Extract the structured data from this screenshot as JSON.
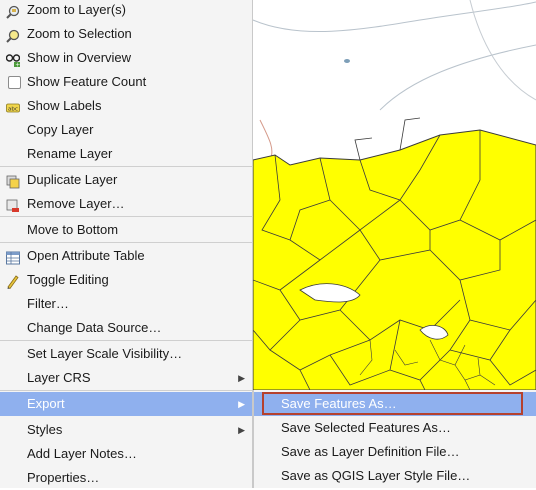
{
  "context_menu": {
    "items": [
      {
        "label": "Zoom to Layer(s)",
        "icon": "zoom-layer-icon"
      },
      {
        "label": "Zoom to Selection",
        "icon": "zoom-selection-icon"
      },
      {
        "label": "Show in Overview",
        "icon": "overview-icon"
      },
      {
        "label": "Show Feature Count",
        "icon": "checkbox-icon"
      },
      {
        "label": "Show Labels",
        "icon": "labels-icon"
      },
      {
        "label": "Copy Layer"
      },
      {
        "label": "Rename Layer"
      },
      {
        "label": "Duplicate Layer",
        "icon": "duplicate-layer-icon"
      },
      {
        "label": "Remove Layer…",
        "icon": "remove-layer-icon"
      },
      {
        "label": "Move to Bottom"
      },
      {
        "label": "Open Attribute Table",
        "icon": "attribute-table-icon"
      },
      {
        "label": "Toggle Editing",
        "icon": "pencil-icon"
      },
      {
        "label": "Filter…"
      },
      {
        "label": "Change Data Source…"
      },
      {
        "label": "Set Layer Scale Visibility…"
      },
      {
        "label": "Layer CRS",
        "submenu": true
      },
      {
        "label": "Export",
        "submenu": true,
        "highlighted": true
      },
      {
        "label": "Styles",
        "submenu": true
      },
      {
        "label": "Add Layer Notes…"
      },
      {
        "label": "Properties…"
      }
    ]
  },
  "export_submenu": {
    "items": [
      {
        "label": "Save Features As…",
        "highlighted": true
      },
      {
        "label": "Save Selected Features As…"
      },
      {
        "label": "Save as Layer Definition File…"
      },
      {
        "label": "Save as QGIS Layer Style File…"
      }
    ]
  },
  "colors": {
    "highlight": "#8fb0ee",
    "annotation_box": "#b5412e",
    "polygon_fill": "#ffff00",
    "polygon_stroke": "#3a3a3a",
    "map_bg": "#ffffff"
  }
}
